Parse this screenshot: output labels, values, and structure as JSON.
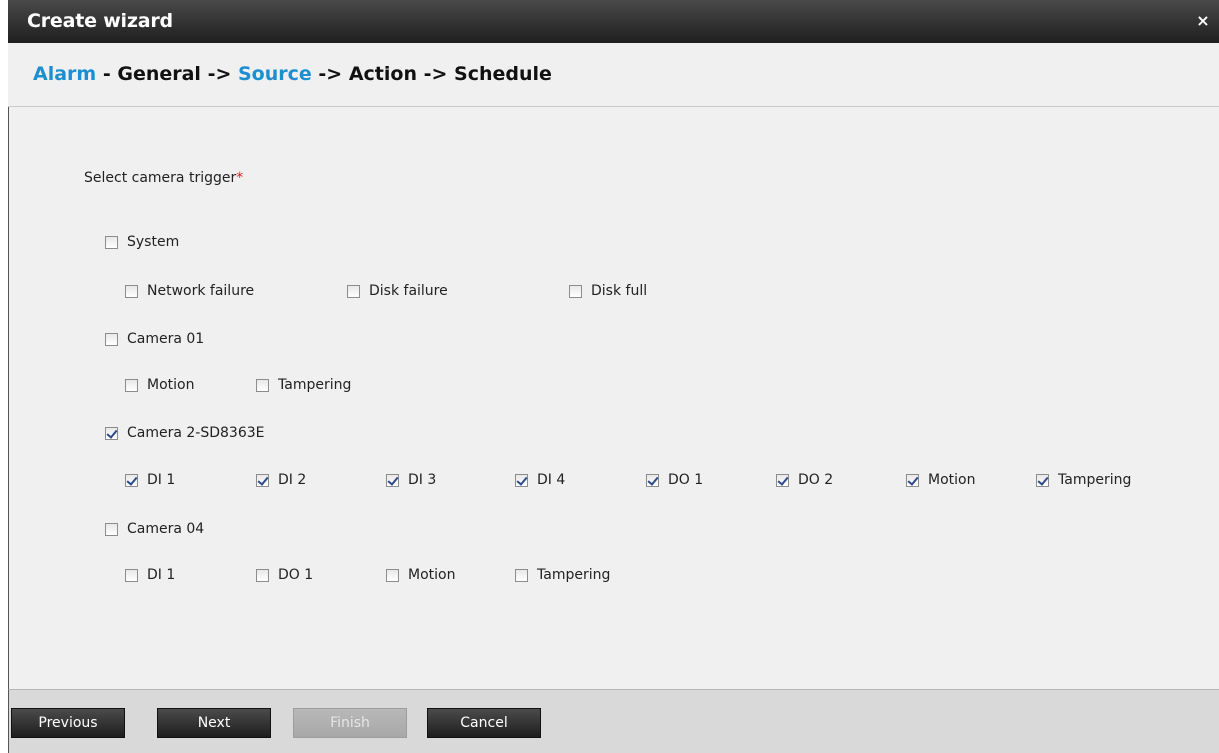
{
  "window": {
    "title": "Create wizard",
    "close_glyph": "×"
  },
  "steps": [
    {
      "label": "Alarm",
      "active": true
    },
    {
      "label": "General",
      "active": false
    },
    {
      "label": "Source",
      "active": true
    },
    {
      "label": "Action",
      "active": false
    },
    {
      "label": "Schedule",
      "active": false
    }
  ],
  "steps_separators": {
    "first": " - ",
    "arrow": " -> "
  },
  "form": {
    "select_label": "Select camera trigger",
    "required_mark": "*"
  },
  "groups": [
    {
      "label": "System",
      "checked": false,
      "options": [
        {
          "label": "Network failure",
          "checked": false
        },
        {
          "label": "Disk failure",
          "checked": false
        },
        {
          "label": "Disk full",
          "checked": false
        }
      ]
    },
    {
      "label": "Camera 01",
      "checked": false,
      "options": [
        {
          "label": "Motion",
          "checked": false
        },
        {
          "label": "Tampering",
          "checked": false
        }
      ]
    },
    {
      "label": "Camera 2-SD8363E",
      "checked": true,
      "options": [
        {
          "label": "DI 1",
          "checked": true
        },
        {
          "label": "DI 2",
          "checked": true
        },
        {
          "label": "DI 3",
          "checked": true
        },
        {
          "label": "DI 4",
          "checked": true
        },
        {
          "label": "DO 1",
          "checked": true
        },
        {
          "label": "DO 2",
          "checked": true
        },
        {
          "label": "Motion",
          "checked": true
        },
        {
          "label": "Tampering",
          "checked": true
        }
      ]
    },
    {
      "label": "Camera 04",
      "checked": false,
      "options": [
        {
          "label": "DI 1",
          "checked": false
        },
        {
          "label": "DO 1",
          "checked": false
        },
        {
          "label": "Motion",
          "checked": false
        },
        {
          "label": "Tampering",
          "checked": false
        }
      ]
    }
  ],
  "buttons": {
    "previous": "Previous",
    "next": "Next",
    "finish": "Finish",
    "cancel": "Cancel"
  },
  "colors": {
    "active_step": "#1c8fd0",
    "required": "#e02020"
  }
}
